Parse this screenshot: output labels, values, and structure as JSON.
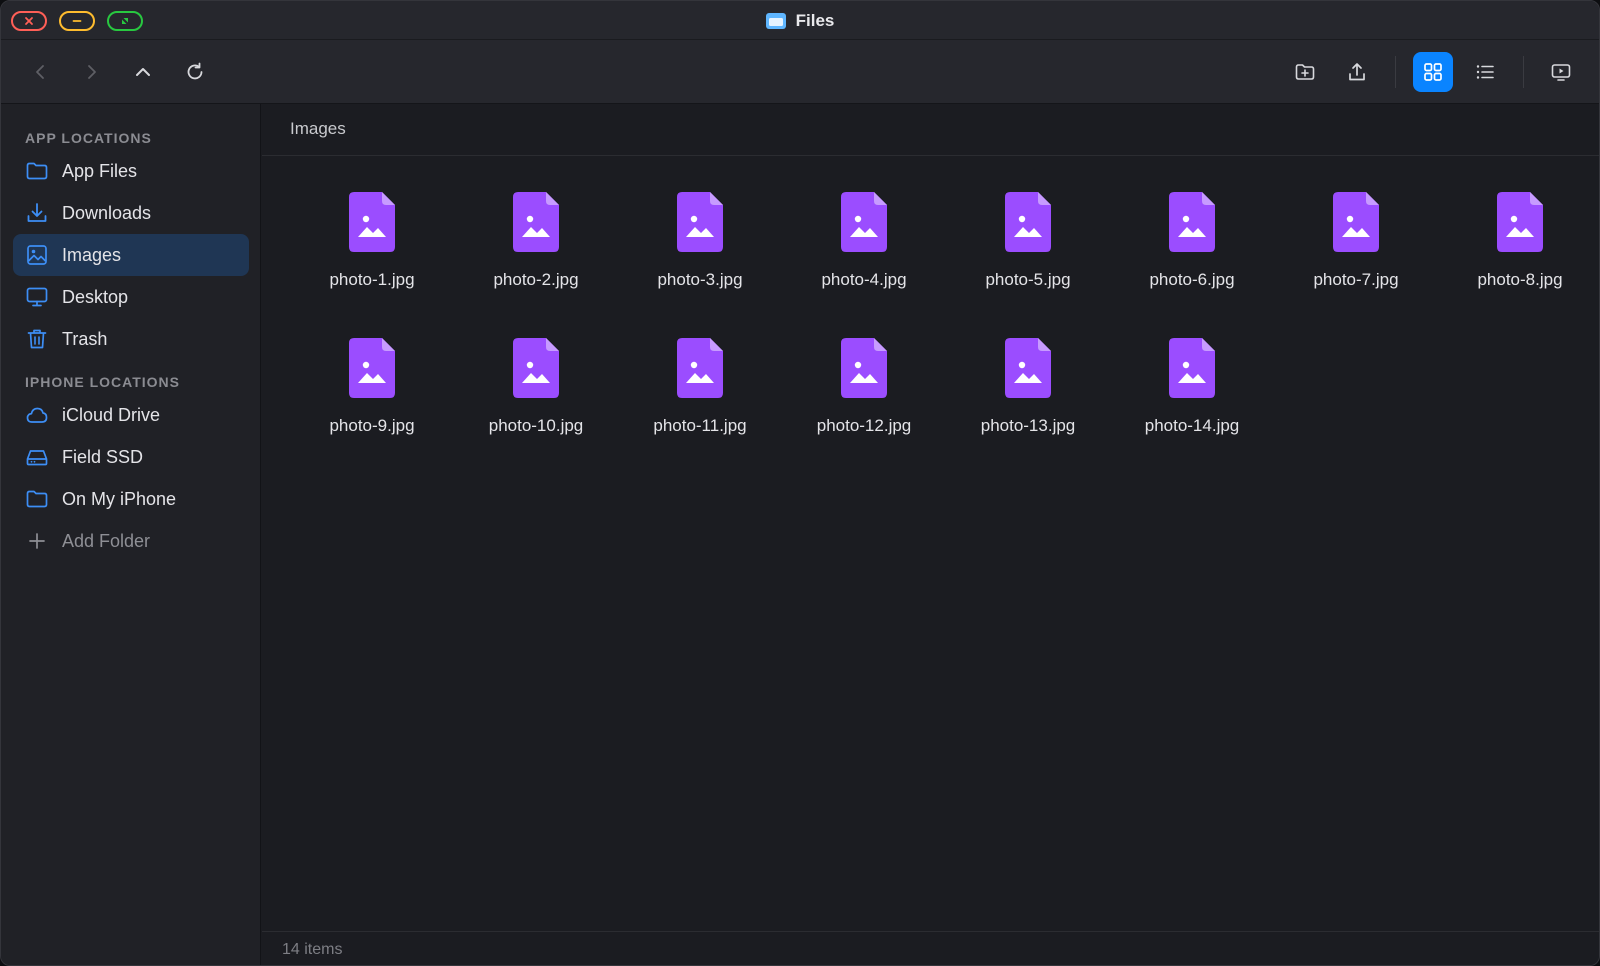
{
  "window": {
    "title": "Files",
    "title_icon": "folder-app-icon"
  },
  "toolbar": {
    "back": "chevron-left-icon",
    "forward": "chevron-right-icon",
    "up": "chevron-up-icon",
    "refresh": "refresh-icon",
    "new_folder": "folder-plus-icon",
    "share": "share-icon",
    "grid_view": "grid-icon",
    "list_view": "list-icon",
    "preview": "preview-icon",
    "active_view": "grid",
    "accent_color": "#0a84ff"
  },
  "sidebar": {
    "app_locations_header": "APP LOCATIONS",
    "app_locations": [
      {
        "label": "App Files",
        "icon": "folder-icon"
      },
      {
        "label": "Downloads",
        "icon": "download-icon"
      },
      {
        "label": "Images",
        "icon": "image-icon",
        "selected": true
      },
      {
        "label": "Desktop",
        "icon": "desktop-icon"
      },
      {
        "label": "Trash",
        "icon": "trash-icon"
      }
    ],
    "iphone_locations_header": "IPHONE LOCATIONS",
    "iphone_locations": [
      {
        "label": "iCloud Drive",
        "icon": "cloud-icon"
      },
      {
        "label": "Field SSD",
        "icon": "drive-icon"
      },
      {
        "label": "On My iPhone",
        "icon": "folder-icon"
      },
      {
        "label": "Add Folder",
        "icon": "plus-icon"
      }
    ]
  },
  "main": {
    "breadcrumb": "Images",
    "files": [
      {
        "name": "photo-1.jpg"
      },
      {
        "name": "photo-2.jpg"
      },
      {
        "name": "photo-3.jpg"
      },
      {
        "name": "photo-4.jpg"
      },
      {
        "name": "photo-5.jpg"
      },
      {
        "name": "photo-6.jpg"
      },
      {
        "name": "photo-7.jpg"
      },
      {
        "name": "photo-8.jpg"
      },
      {
        "name": "photo-9.jpg"
      },
      {
        "name": "photo-10.jpg"
      },
      {
        "name": "photo-11.jpg"
      },
      {
        "name": "photo-12.jpg"
      },
      {
        "name": "photo-13.jpg"
      },
      {
        "name": "photo-14.jpg"
      }
    ],
    "file_icon": "image-file-icon",
    "file_icon_color": "#9b4dff",
    "status": "14 items"
  }
}
